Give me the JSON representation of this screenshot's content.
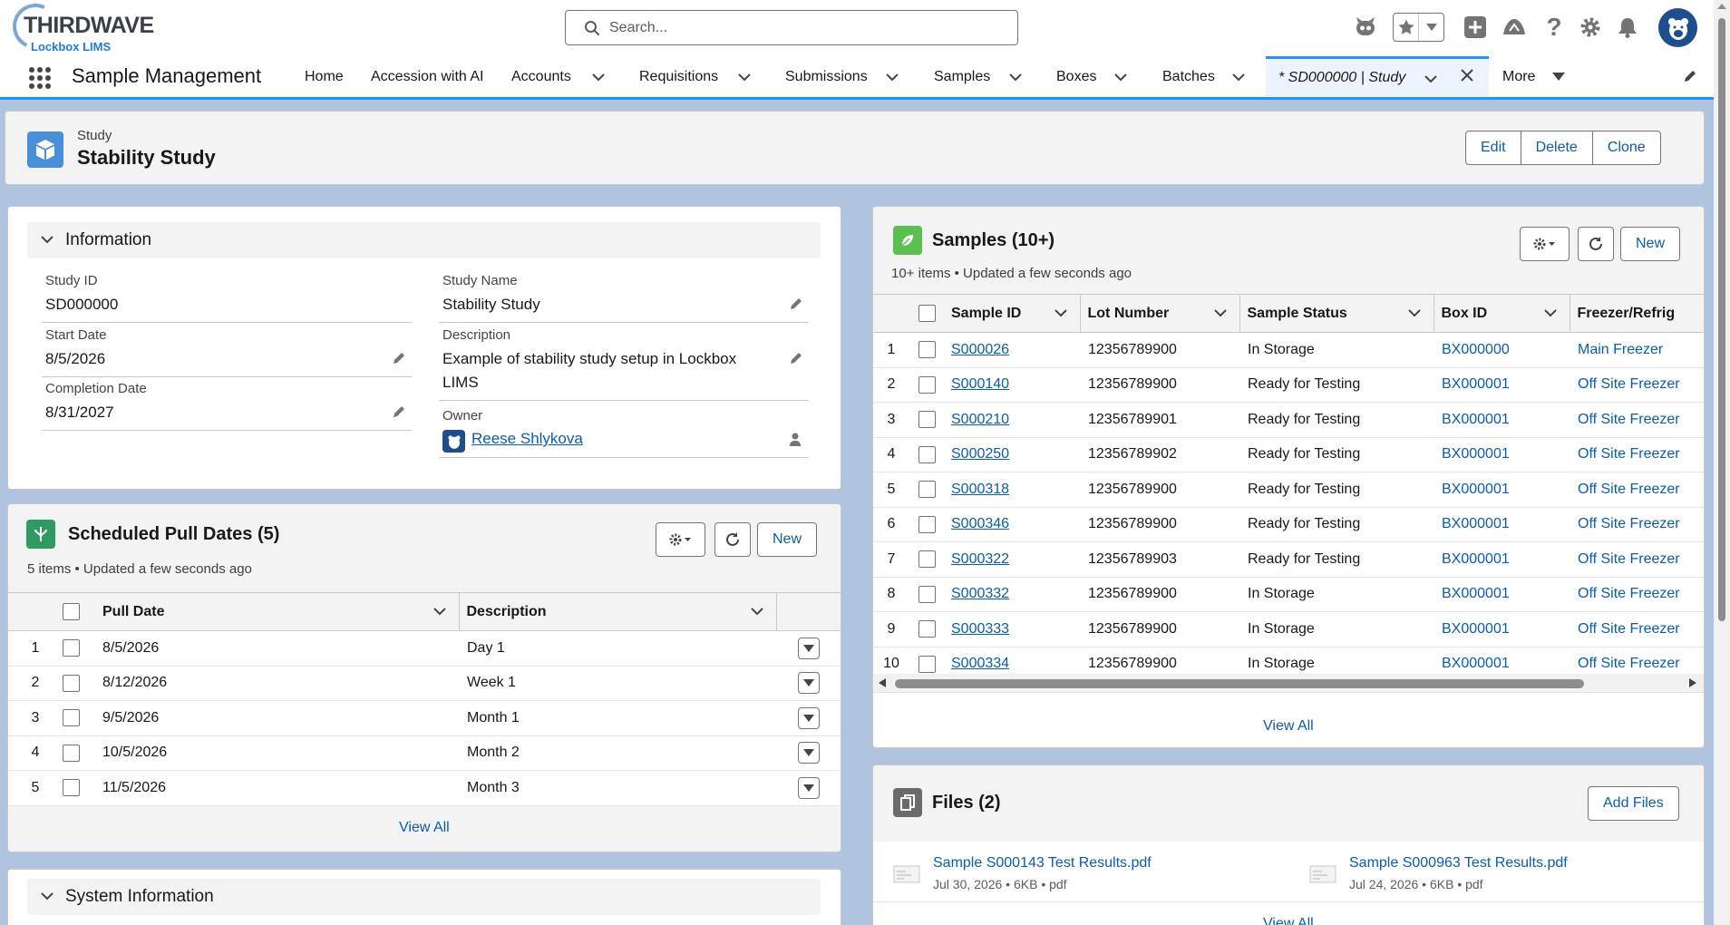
{
  "header": {
    "logo_main": "THIRDWAVE",
    "logo_sub": "Lockbox LIMS",
    "search_placeholder": "Search..."
  },
  "nav": {
    "app_name": "Sample Management",
    "items": [
      {
        "label": "Home",
        "has_menu": false
      },
      {
        "label": "Accession with AI",
        "has_menu": false
      },
      {
        "label": "Accounts",
        "has_menu": true
      },
      {
        "label": "Requisitions",
        "has_menu": true
      },
      {
        "label": "Submissions",
        "has_menu": true
      },
      {
        "label": "Samples",
        "has_menu": true
      },
      {
        "label": "Boxes",
        "has_menu": true
      },
      {
        "label": "Batches",
        "has_menu": true
      }
    ],
    "active_tab": "* SD000000 | Study",
    "more_label": "More"
  },
  "record": {
    "type": "Study",
    "title": "Stability Study",
    "actions": [
      "Edit",
      "Delete",
      "Clone"
    ]
  },
  "information": {
    "section_title": "Information",
    "study_id_label": "Study ID",
    "study_id": "SD000000",
    "start_date_label": "Start Date",
    "start_date": "8/5/2026",
    "completion_date_label": "Completion Date",
    "completion_date": "8/31/2027",
    "study_name_label": "Study Name",
    "study_name": "Stability Study",
    "description_label": "Description",
    "description": "Example of stability study setup in Lockbox LIMS",
    "owner_label": "Owner",
    "owner": "Reese Shlykova"
  },
  "pull_dates": {
    "title": "Scheduled Pull Dates (5)",
    "subtitle": "5 items • Updated a few seconds ago",
    "new_label": "New",
    "columns": [
      "Pull Date",
      "Description"
    ],
    "rows": [
      {
        "num": "1",
        "date": "8/5/2026",
        "desc": "Day 1"
      },
      {
        "num": "2",
        "date": "8/12/2026",
        "desc": "Week 1"
      },
      {
        "num": "3",
        "date": "9/5/2026",
        "desc": "Month 1"
      },
      {
        "num": "4",
        "date": "10/5/2026",
        "desc": "Month 2"
      },
      {
        "num": "5",
        "date": "11/5/2026",
        "desc": "Month 3"
      }
    ],
    "view_all": "View All"
  },
  "system_info": {
    "title": "System Information"
  },
  "samples": {
    "title": "Samples (10+)",
    "subtitle": "10+ items • Updated a few seconds ago",
    "new_label": "New",
    "columns": [
      "Sample ID",
      "Lot Number",
      "Sample Status",
      "Box ID",
      "Freezer/Refrig"
    ],
    "rows": [
      {
        "num": "1",
        "id": "S000026",
        "lot": "12356789900",
        "status": "In Storage",
        "box": "BX000000",
        "freezer": "Main Freezer"
      },
      {
        "num": "2",
        "id": "S000140",
        "lot": "12356789900",
        "status": "Ready for Testing",
        "box": "BX000001",
        "freezer": "Off Site Freezer"
      },
      {
        "num": "3",
        "id": "S000210",
        "lot": "12356789901",
        "status": "Ready for Testing",
        "box": "BX000001",
        "freezer": "Off Site Freezer"
      },
      {
        "num": "4",
        "id": "S000250",
        "lot": "12356789902",
        "status": "Ready for Testing",
        "box": "BX000001",
        "freezer": "Off Site Freezer"
      },
      {
        "num": "5",
        "id": "S000318",
        "lot": "12356789900",
        "status": "Ready for Testing",
        "box": "BX000001",
        "freezer": "Off Site Freezer"
      },
      {
        "num": "6",
        "id": "S000346",
        "lot": "12356789900",
        "status": "Ready for Testing",
        "box": "BX000001",
        "freezer": "Off Site Freezer"
      },
      {
        "num": "7",
        "id": "S000322",
        "lot": "12356789903",
        "status": "Ready for Testing",
        "box": "BX000001",
        "freezer": "Off Site Freezer"
      },
      {
        "num": "8",
        "id": "S000332",
        "lot": "12356789900",
        "status": "In Storage",
        "box": "BX000001",
        "freezer": "Off Site Freezer"
      },
      {
        "num": "9",
        "id": "S000333",
        "lot": "12356789900",
        "status": "In Storage",
        "box": "BX000001",
        "freezer": "Off Site Freezer"
      },
      {
        "num": "10",
        "id": "S000334",
        "lot": "12356789900",
        "status": "In Storage",
        "box": "BX000001",
        "freezer": "Off Site Freezer"
      }
    ],
    "view_all": "View All"
  },
  "files": {
    "title": "Files (2)",
    "add_label": "Add Files",
    "items": [
      {
        "name": "Sample S000143 Test Results.pdf",
        "meta": "Jul 30, 2026 • 6KB • pdf"
      },
      {
        "name": "Sample S000963 Test Results.pdf",
        "meta": "Jul 24, 2026 • 6KB • pdf"
      }
    ],
    "view_all": "View All"
  },
  "colors": {
    "brand_blue": "#1b96ff",
    "link": "#0b5cab",
    "page_bg": "#b0c4df",
    "study_icon": "#4a90d9",
    "pull_icon": "#2e9a62",
    "samples_icon": "#5cbf4f",
    "files_icon": "#6b6b6b"
  }
}
